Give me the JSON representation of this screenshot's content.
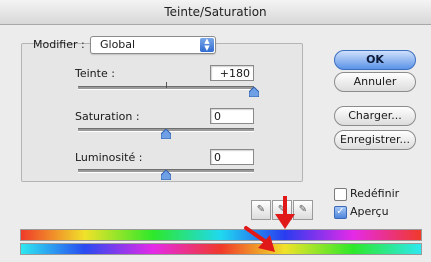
{
  "window": {
    "title": "Teinte/Saturation"
  },
  "modifier": {
    "label": "Modifier :",
    "selected": "Global"
  },
  "sliders": [
    {
      "label": "Teinte :",
      "value": "+180",
      "level": 1.0
    },
    {
      "label": "Saturation :",
      "value": "0",
      "level": 0.5
    },
    {
      "label": "Luminosité :",
      "value": "0",
      "level": 0.5
    }
  ],
  "buttons": {
    "ok": "OK",
    "cancel": "Annuler",
    "load": "Charger...",
    "save": "Enregistrer..."
  },
  "options": {
    "colorize": {
      "label": "Redéfinir",
      "checked": false
    },
    "preview": {
      "label": "Aperçu",
      "checked": true
    }
  },
  "icons": {
    "dropdown": "chevron-up-down-icon",
    "eyedroppers": [
      "eyedropper-icon",
      "eyedropper-plus-icon",
      "eyedropper-minus-icon"
    ],
    "annotations": [
      "red-arrow-down-icon",
      "red-arrow-diagonal-icon"
    ]
  },
  "colors": {
    "accent": "#4f86dc",
    "annotation": "#e01818"
  }
}
